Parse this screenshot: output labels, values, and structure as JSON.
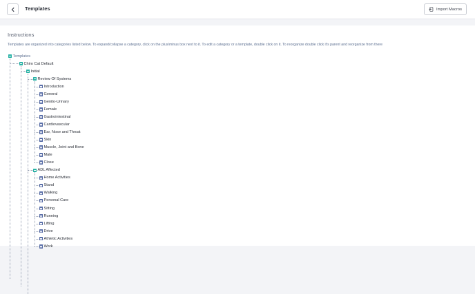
{
  "header": {
    "title": "Templates",
    "import_label": "Import Macros"
  },
  "instructions": {
    "title": "Instructions",
    "text": "Templates are organized into categories listed below. To expand/collapse a category, click on the plus/minus box next to it. To edit a category or a template, double click on it. To reorganize double click it's parent and reorganize from there"
  },
  "tree": {
    "root": "Templates",
    "category": "Chiro Cat Default",
    "subcategory": "Initial",
    "groups": [
      {
        "label": "Review Of Systems",
        "items": [
          "Introduction",
          "General",
          "Genito-Urinary",
          "Female",
          "Gastrointestinal",
          "Cardiovascular",
          "Ear, Nose and Throat",
          "Skin",
          "Muscle, Joint and Bone",
          "Male",
          "Close"
        ]
      },
      {
        "label": "ADL Affected",
        "items": [
          "Home Activities",
          "Stand",
          "Walking",
          "Personal Care",
          "Sitting",
          "Running",
          "Lifting",
          "Drive",
          "Athletic Activities",
          "Work"
        ]
      }
    ]
  },
  "colors": {
    "toggle": "#2bb3a6",
    "doc_icon": "#5a6fa8",
    "instructions_text": "#5d7091"
  }
}
